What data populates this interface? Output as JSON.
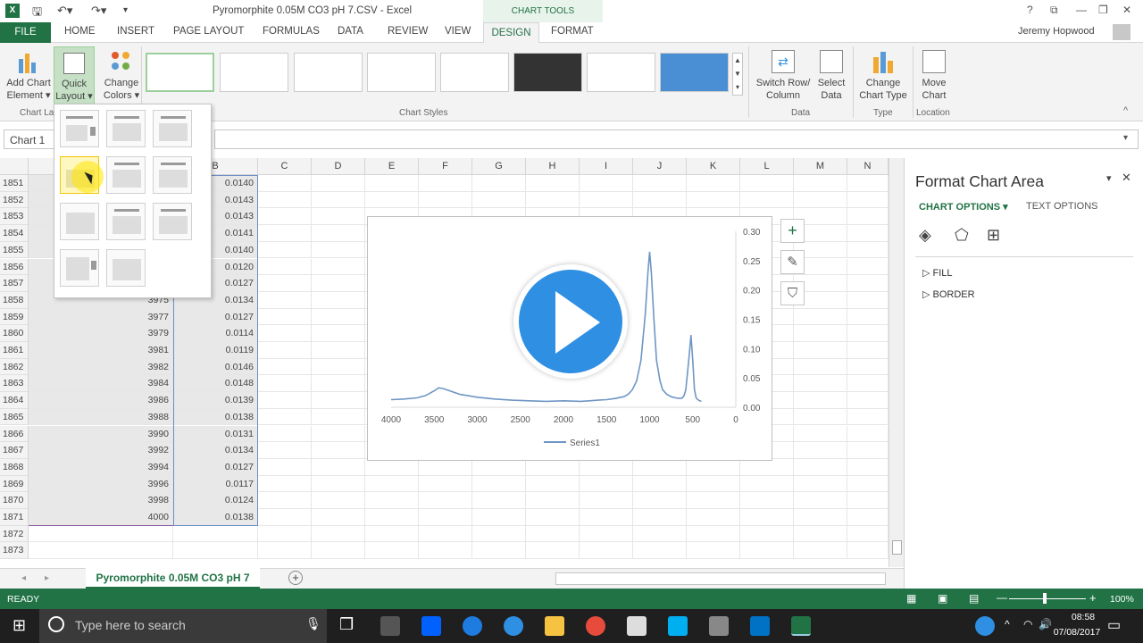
{
  "window": {
    "title": "Pyromorphite 0.05M CO3 pH 7.CSV - Excel",
    "context_band": "CHART TOOLS",
    "user": "Jeremy Hopwood"
  },
  "tabs": {
    "file": "FILE",
    "items": [
      "HOME",
      "INSERT",
      "PAGE LAYOUT",
      "FORMULAS",
      "DATA",
      "REVIEW",
      "VIEW"
    ],
    "design": "DESIGN",
    "format": "FORMAT"
  },
  "ribbon": {
    "add_chart_element": [
      "Add Chart",
      "Element ▾"
    ],
    "quick_layout": [
      "Quick",
      "Layout ▾"
    ],
    "change_colors": [
      "Change",
      "Colors ▾"
    ],
    "group_chart_layouts": "Chart La",
    "group_chart_styles": "Chart Styles",
    "switch_row_column": [
      "Switch Row/",
      "Column"
    ],
    "select_data": [
      "Select",
      "Data"
    ],
    "group_data": "Data",
    "change_chart_type": [
      "Change",
      "Chart Type"
    ],
    "group_type": "Type",
    "move_chart": [
      "Move",
      "Chart"
    ],
    "group_location": "Location"
  },
  "formula_bar": {
    "name_box": "Chart 1"
  },
  "columns": [
    "B",
    "C",
    "D",
    "E",
    "F",
    "G",
    "H",
    "I",
    "J",
    "K",
    "L",
    "M",
    "N"
  ],
  "rows": [
    {
      "n": "1851",
      "a": "",
      "b": "0.0140"
    },
    {
      "n": "1852",
      "a": "",
      "b": "0.0143"
    },
    {
      "n": "1853",
      "a": "",
      "b": "0.0143"
    },
    {
      "n": "1854",
      "a": "",
      "b": "0.0141"
    },
    {
      "n": "1855",
      "a": "",
      "b": "0.0140"
    },
    {
      "n": "1856",
      "a": "",
      "b": "0.0120"
    },
    {
      "n": "1857",
      "a": "",
      "b": "0.0127"
    },
    {
      "n": "1858",
      "a": "3975",
      "b": "0.0134"
    },
    {
      "n": "1859",
      "a": "3977",
      "b": "0.0127"
    },
    {
      "n": "1860",
      "a": "3979",
      "b": "0.0114"
    },
    {
      "n": "1861",
      "a": "3981",
      "b": "0.0119"
    },
    {
      "n": "1862",
      "a": "3982",
      "b": "0.0146"
    },
    {
      "n": "1863",
      "a": "3984",
      "b": "0.0148"
    },
    {
      "n": "1864",
      "a": "3986",
      "b": "0.0139"
    },
    {
      "n": "1865",
      "a": "3988",
      "b": "0.0138"
    },
    {
      "n": "1866",
      "a": "3990",
      "b": "0.0131"
    },
    {
      "n": "1867",
      "a": "3992",
      "b": "0.0134"
    },
    {
      "n": "1868",
      "a": "3994",
      "b": "0.0127"
    },
    {
      "n": "1869",
      "a": "3996",
      "b": "0.0117"
    },
    {
      "n": "1870",
      "a": "3998",
      "b": "0.0124"
    },
    {
      "n": "1871",
      "a": "4000",
      "b": "0.0138"
    },
    {
      "n": "1872",
      "a": "",
      "b": ""
    },
    {
      "n": "1873",
      "a": "",
      "b": ""
    }
  ],
  "chart_data": {
    "type": "line",
    "title": "",
    "xlabel": "",
    "ylabel": "",
    "xlim": [
      4000,
      0
    ],
    "ylim": [
      0,
      0.3
    ],
    "x_reversed": true,
    "y_axis_side": "right",
    "x_ticks": [
      "4000",
      "3500",
      "3000",
      "2500",
      "2000",
      "1500",
      "1000",
      "500",
      "0"
    ],
    "y_ticks": [
      "0.00",
      "0.05",
      "0.10",
      "0.15",
      "0.20",
      "0.25",
      "0.30"
    ],
    "legend": "bottom",
    "series": [
      {
        "name": "Series1",
        "x": [
          4000,
          3850,
          3700,
          3600,
          3500,
          3450,
          3400,
          3300,
          3200,
          3000,
          2800,
          2600,
          2400,
          2200,
          2000,
          1800,
          1700,
          1600,
          1500,
          1400,
          1300,
          1250,
          1200,
          1150,
          1100,
          1050,
          1020,
          1000,
          980,
          950,
          920,
          880,
          850,
          800,
          750,
          700,
          650,
          620,
          600,
          580,
          560,
          540,
          520,
          500,
          480,
          460,
          440,
          420,
          400
        ],
        "y": [
          0.013,
          0.014,
          0.016,
          0.02,
          0.028,
          0.033,
          0.032,
          0.027,
          0.022,
          0.017,
          0.014,
          0.012,
          0.011,
          0.01,
          0.011,
          0.01,
          0.011,
          0.012,
          0.013,
          0.015,
          0.018,
          0.022,
          0.03,
          0.045,
          0.08,
          0.16,
          0.23,
          0.265,
          0.23,
          0.15,
          0.08,
          0.045,
          0.03,
          0.022,
          0.018,
          0.016,
          0.015,
          0.016,
          0.02,
          0.03,
          0.06,
          0.09,
          0.123,
          0.08,
          0.03,
          0.016,
          0.013,
          0.011,
          0.01
        ]
      }
    ],
    "color": "#6e96c4"
  },
  "pane": {
    "title": "Format Chart Area",
    "tab_chart_options": "CHART OPTIONS",
    "tab_text_options": "TEXT OPTIONS",
    "fill": "FILL",
    "border": "BORDER"
  },
  "sheet": {
    "tab_name": "Pyromorphite 0.05M CO3 pH 7"
  },
  "status": {
    "ready": "READY",
    "zoom": "100%"
  },
  "taskbar": {
    "search_placeholder": "Type here to search",
    "time": "08:58",
    "date": "07/08/2017"
  },
  "colors": {
    "excel_green": "#217346",
    "play_blue": "#2e8fe3"
  }
}
